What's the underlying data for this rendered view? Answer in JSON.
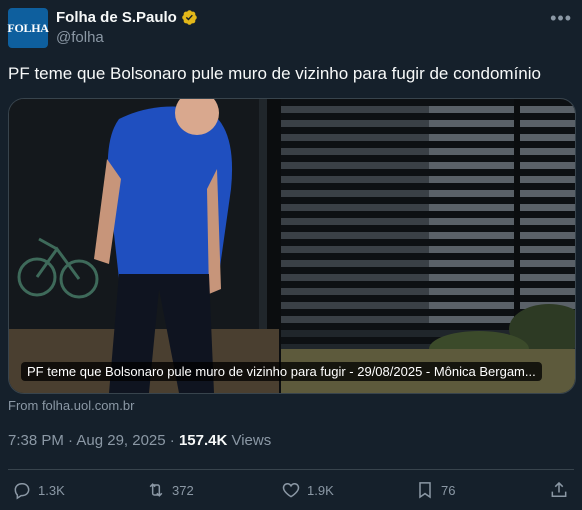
{
  "author": {
    "avatar_text": "FOLHA",
    "display_name": "Folha de S.Paulo",
    "handle": "@folha"
  },
  "tweet": {
    "text": "PF teme que Bolsonaro pule muro de vizinho para fugir de condomínio",
    "card_caption": "PF teme que Bolsonaro pule muro de vizinho para fugir - 29/08/2025 - Mônica Bergam...",
    "source": "From folha.uol.com.br",
    "time": "7:38 PM · Aug 29, 2025 · ",
    "views_count": "157.4K",
    "views_label": " Views"
  },
  "actions": {
    "replies": "1.3K",
    "reposts": "372",
    "likes": "1.9K",
    "bookmarks": "76"
  },
  "colors": {
    "background": "#15202b",
    "muted": "#8b98a5",
    "verified": "#e2b719",
    "brand": "#0e5f9e"
  },
  "icons": [
    "verified-badge-icon",
    "more-icon",
    "reply-icon",
    "repost-icon",
    "like-icon",
    "bookmark-icon",
    "share-icon"
  ]
}
